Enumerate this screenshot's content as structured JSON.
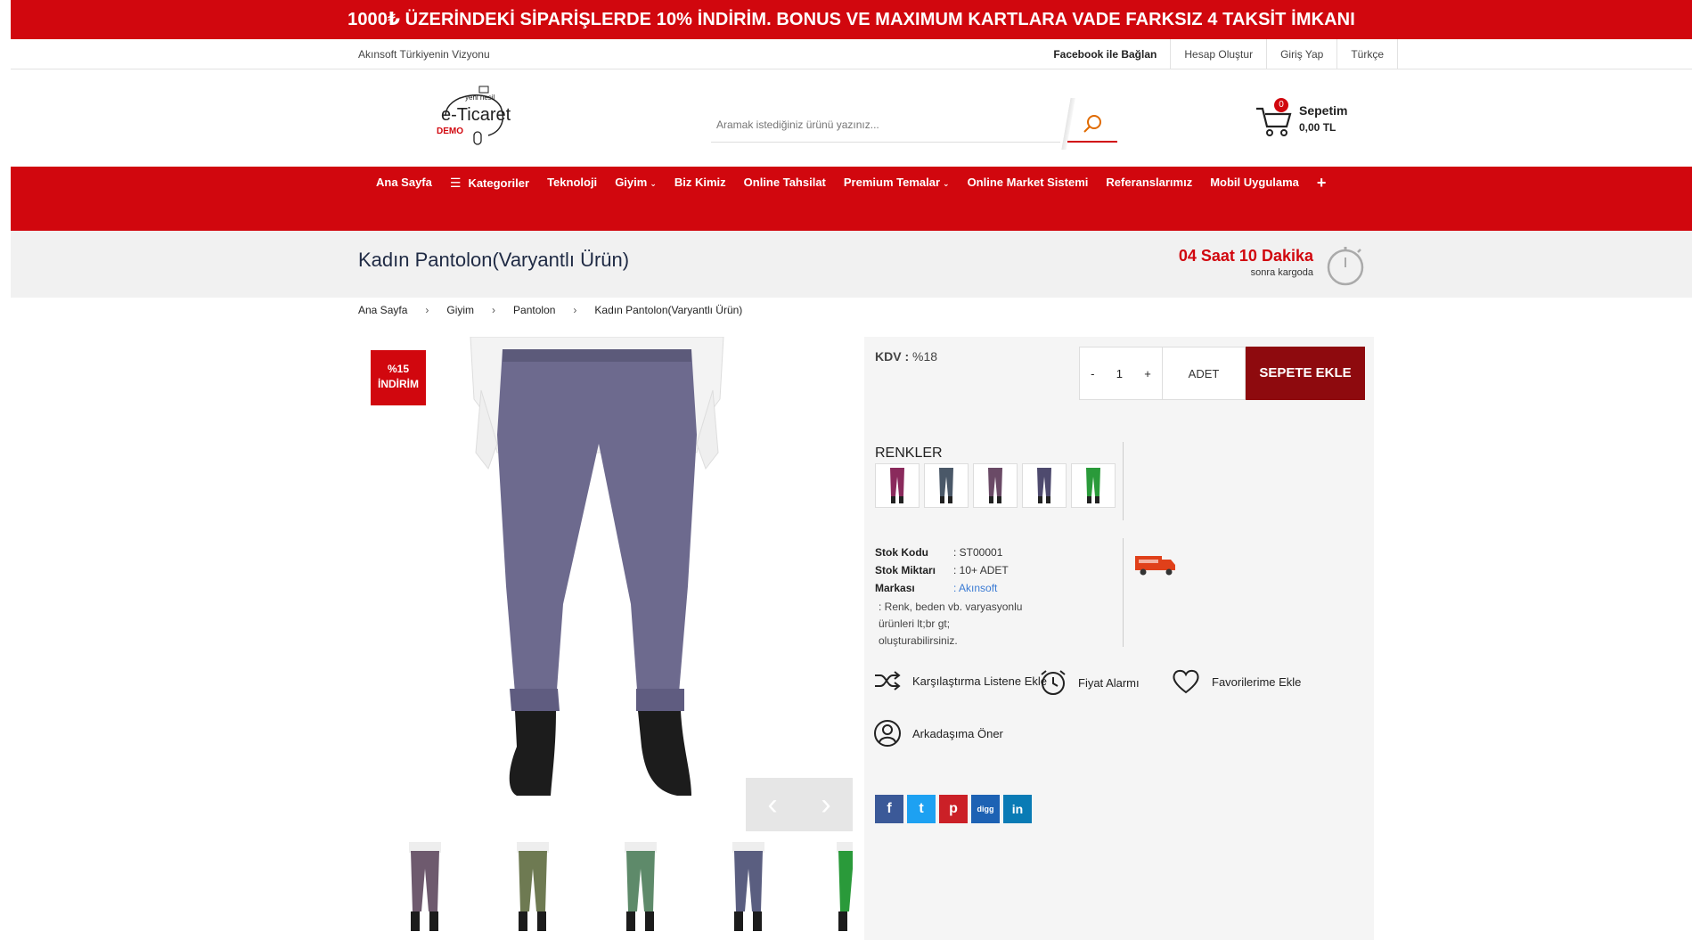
{
  "promo": {
    "text": "1000₺ ÜZERİNDEKİ SİPARİŞLERDE 10% İNDİRİM. BONUS VE MAXIMUM KARTLARA VADE FARKSIZ 4 TAKSİT İMKANI"
  },
  "topbar": {
    "tagline": "Akınsoft Türkiyenin Vizyonu",
    "links": {
      "facebook": "Facebook ile Bağlan",
      "register": "Hesap Oluştur",
      "login": "Giriş Yap",
      "language": "Türkçe"
    }
  },
  "header": {
    "logo": {
      "line1": "yeni nesil",
      "line2": "e-Ticaret",
      "line3": "DEMO"
    },
    "search_placeholder": "Aramak istediğiniz ürünü yazınız...",
    "cart": {
      "count": "0",
      "label": "Sepetim",
      "amount": "0,00 TL"
    }
  },
  "nav": {
    "items": [
      "Ana Sayfa",
      "Kategoriler",
      "Teknoloji",
      "Giyim",
      "Biz Kimiz",
      "Online Tahsilat",
      "Premium Temalar",
      "Online Market Sistemi",
      "Referanslarımız",
      "Mobil Uygulama"
    ],
    "plus": "+"
  },
  "product": {
    "title": "Kadın Pantolon(Varyantlı Ürün)",
    "shipping_time": "04 Saat 10 Dakika",
    "shipping_sub": "sonra kargoda",
    "breadcrumb": [
      "Ana Sayfa",
      "Giyim",
      "Pantolon",
      "Kadın Pantolon(Varyantlı Ürün)"
    ],
    "discount_line1": "%15",
    "discount_line2": "İNDİRİM",
    "kdv_label": "KDV :",
    "kdv_value": "%18",
    "qty": "1",
    "qty_minus": "-",
    "qty_plus": "+",
    "unit": "ADET",
    "add_to_cart": "SEPETE EKLE",
    "colors_title": "RENKLER",
    "stock_code_label": "Stok Kodu",
    "stock_code": ": ST00001",
    "stock_qty_label": "Stok Miktarı",
    "stock_qty": ": 10+ ADET",
    "brand_label": "Markası",
    "brand": ": Akınsoft",
    "description": ": Renk, beden vb. varyasyonlu ürünleri lt;br gt; oluşturabilirsiniz.",
    "actions": {
      "compare": "Karşılaştırma Listene Ekle",
      "price_alarm": "Fiyat Alarmı",
      "favorites": "Favorilerime Ekle",
      "recommend": "Arkadaşıma Öner"
    },
    "social": {
      "facebook": "f",
      "twitter": "t",
      "pinterest": "p",
      "digg": "digg",
      "linkedin": "in"
    },
    "prev": "‹",
    "next": "›"
  },
  "colors": {
    "accent": "#d1070e",
    "cart_button": "#8e0a0e",
    "swatches": [
      "#8a2a5c",
      "#4a5868",
      "#6a4a66",
      "#4e4a6e",
      "#2a9a3a"
    ],
    "thumbs": [
      "#6e5a6e",
      "#6e7a52",
      "#5e8a6a",
      "#5a5e80",
      "#2a9a3a"
    ]
  }
}
